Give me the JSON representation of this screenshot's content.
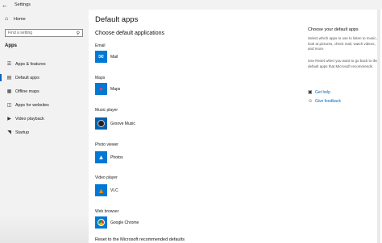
{
  "window": {
    "title": "Settings",
    "back_icon": "back-arrow-icon"
  },
  "sidebar": {
    "home_label": "Home",
    "search_placeholder": "Find a setting",
    "section_title": "Apps",
    "items": [
      {
        "label": "Apps & features",
        "icon": "list-icon"
      },
      {
        "label": "Default apps",
        "icon": "default-apps-icon",
        "active": true
      },
      {
        "label": "Offline maps",
        "icon": "map-icon"
      },
      {
        "label": "Apps for websites",
        "icon": "link-icon"
      },
      {
        "label": "Video playback",
        "icon": "video-icon"
      },
      {
        "label": "Startup",
        "icon": "startup-icon"
      }
    ]
  },
  "main": {
    "title": "Default apps",
    "subtitle": "Choose default applications",
    "categories": [
      {
        "label": "Email",
        "app": "Mail",
        "icon": "mail-icon",
        "color": "#0078d4"
      },
      {
        "label": "Maps",
        "app": "Maps",
        "icon": "maps-icon",
        "color": "#0078d4"
      },
      {
        "label": "Music player",
        "app": "Groove Music",
        "icon": "groove-music-icon",
        "color": "#0063b1"
      },
      {
        "label": "Photo viewer",
        "app": "Photos",
        "icon": "photos-icon",
        "color": "#0078d4"
      },
      {
        "label": "Video player",
        "app": "VLC",
        "icon": "vlc-icon",
        "color": "#0078d4"
      },
      {
        "label": "Web browser",
        "app": "Google Chrome",
        "icon": "chrome-icon",
        "color": "#0078d4"
      }
    ],
    "reset_label": "Reset to the Microsoft recommended defaults"
  },
  "right_panel": {
    "title": "Choose your default apps",
    "para1": "Select which apps to use to listen to music, look at pictures, check mail, watch videos, and more.",
    "para2": "Use Reset when you want to go back to the default apps that Microsoft recommends.",
    "help_label": "Get help",
    "feedback_label": "Give feedback"
  },
  "colors": {
    "accent": "#0067c0",
    "sidebar_bg": "#f2f2f2"
  }
}
